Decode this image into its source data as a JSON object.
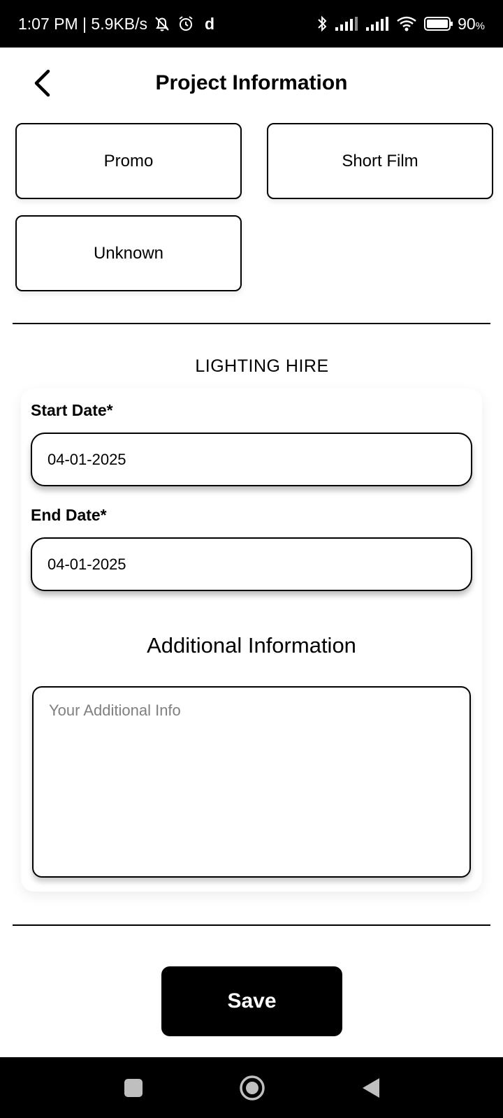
{
  "status_bar": {
    "time_speed": "1:07 PM | 5.9KB/s",
    "app_glyph": "d",
    "battery": "90",
    "battery_unit": "%"
  },
  "header": {
    "title": "Project Information"
  },
  "project_types": {
    "options": [
      "Promo",
      "Short Film",
      "Unknown"
    ]
  },
  "section": {
    "title": "LIGHTING HIRE"
  },
  "form": {
    "start_label": "Start Date*",
    "start_value": "04-01-2025",
    "end_label": "End Date*",
    "end_value": "04-01-2025",
    "info_heading": "Additional Information",
    "info_placeholder": "Your Additional Info"
  },
  "actions": {
    "save_label": "Save"
  },
  "icons": {
    "status": [
      "mute-bell-icon",
      "alarm-icon",
      "bluetooth-icon",
      "signal-icon",
      "wifi-icon",
      "battery-icon"
    ],
    "nav": [
      "recents-icon",
      "home-icon",
      "back-icon"
    ]
  }
}
